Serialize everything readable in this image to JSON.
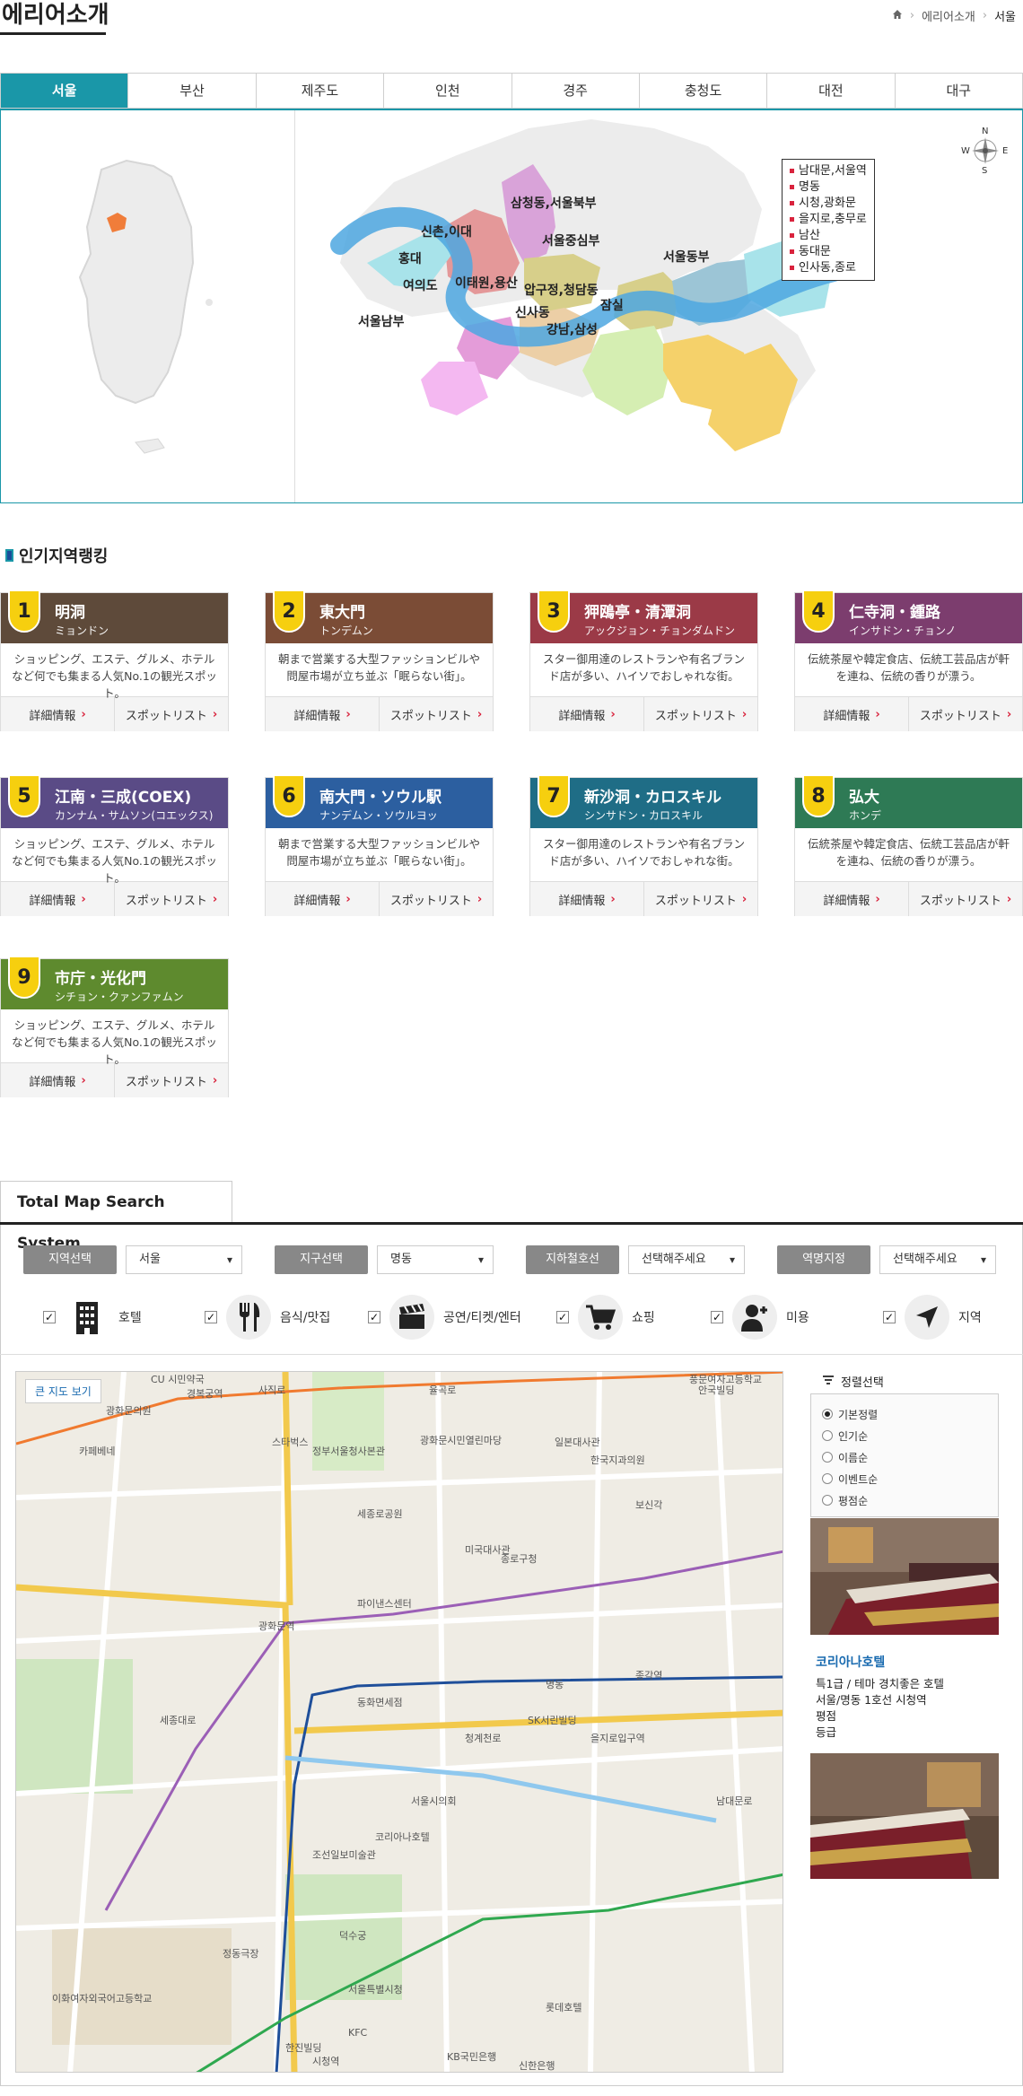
{
  "page": {
    "title": "에리어소개"
  },
  "breadcrumb": {
    "home_icon": "home-icon",
    "item1": "에리어소개",
    "current": "서울"
  },
  "tabs": [
    {
      "label": "서울",
      "active": true
    },
    {
      "label": "부산"
    },
    {
      "label": "제주도"
    },
    {
      "label": "인천"
    },
    {
      "label": "경주"
    },
    {
      "label": "충청도"
    },
    {
      "label": "대전"
    },
    {
      "label": "대구"
    }
  ],
  "compass": {
    "n": "N",
    "s": "S",
    "e": "E",
    "w": "W"
  },
  "zones": [
    {
      "label": "삼청동,서울북부"
    },
    {
      "label": "신촌,이대"
    },
    {
      "label": "서울중심부"
    },
    {
      "label": "홍대"
    },
    {
      "label": "서울동부"
    },
    {
      "label": "여의도"
    },
    {
      "label": "이태원,용산"
    },
    {
      "label": "압구정,청담동"
    },
    {
      "label": "신사동"
    },
    {
      "label": "잠실"
    },
    {
      "label": "강남,삼성"
    },
    {
      "label": "서울남부"
    }
  ],
  "legend": [
    "남대문,서울역",
    "명동",
    "시청,광화문",
    "을지로,충무로",
    "남산",
    "동대문",
    "인사동,종로"
  ],
  "ranking": {
    "title": "인기지역랭킹",
    "cards": [
      {
        "num": "1",
        "jp": "明洞",
        "kana": "ミョンドン",
        "color": "#5e4a3a",
        "desc": "ショッピング、エステ、グルメ、ホテルなど何でも集まる人気No.1の観光スポット。",
        "btn1": "詳細情報",
        "btn2": "スポットリスト"
      },
      {
        "num": "2",
        "jp": "東大門",
        "kana": "トンデムン",
        "color": "#7b4c36",
        "desc": "朝まで営業する大型ファッションビルや問屋市場が立ち並ぶ「眠らない街」。",
        "btn1": "詳細情報",
        "btn2": "スポットリスト"
      },
      {
        "num": "3",
        "jp": "狎鴎亭・清潭洞",
        "kana": "アックジョン・チョンダムドン",
        "color": "#9b3a47",
        "desc": "スター御用達のレストランや有名ブランド店が多い、ハイソでおしゃれな街。",
        "btn1": "詳細情報",
        "btn2": "スポットリスト"
      },
      {
        "num": "4",
        "jp": "仁寺洞・鍾路",
        "kana": "インサドン・チョンノ",
        "color": "#7c3d6e",
        "desc": "伝統茶屋や韓定食店、伝統工芸品店が軒を連ね、伝統の香りが漂う。",
        "btn1": "詳細情報",
        "btn2": "スポットリスト"
      },
      {
        "num": "5",
        "jp": "江南・三成(COEX)",
        "kana": "カンナム・サムソン(コエックス)",
        "color": "#5a4b86",
        "desc": "ショッピング、エステ、グルメ、ホテルなど何でも集まる人気No.1の観光スポット。",
        "btn1": "詳細情報",
        "btn2": "スポットリスト"
      },
      {
        "num": "6",
        "jp": "南大門・ソウル駅",
        "kana": "ナンデムン・ソウルヨッ",
        "color": "#2c5fa0",
        "desc": "朝まで営業する大型ファッションビルや問屋市場が立ち並ぶ「眠らない街」。",
        "btn1": "詳細情報",
        "btn2": "スポットリスト"
      },
      {
        "num": "7",
        "jp": "新沙洞・カロスキル",
        "kana": "シンサドン・カロスキル",
        "color": "#1f6d86",
        "desc": "スター御用達のレストランや有名ブランド店が多い、ハイソでおしゃれな街。",
        "btn1": "詳細情報",
        "btn2": "スポットリスト"
      },
      {
        "num": "8",
        "jp": "弘大",
        "kana": "ホンデ",
        "color": "#2e7a55",
        "desc": "伝統茶屋や韓定食店、伝統工芸品店が軒を連ね、伝統の香りが漂う。",
        "btn1": "詳細情報",
        "btn2": "スポットリスト"
      },
      {
        "num": "9",
        "jp": "市庁・光化門",
        "kana": "シチョン・クァンファムン",
        "color": "#5e8a2e",
        "desc": "ショッピング、エステ、グルメ、ホテルなど何でも集まる人気No.1の観光スポット。",
        "btn1": "詳細情報",
        "btn2": "スポットリスト"
      }
    ]
  },
  "total_map": {
    "tab": "Total Map Search System",
    "filters": [
      {
        "label": "지역선택",
        "value": "서울"
      },
      {
        "label": "지구선택",
        "value": "명동"
      },
      {
        "label": "지하철호선",
        "value": "선택해주세요"
      },
      {
        "label": "역명지정",
        "value": "선택해주세요"
      }
    ],
    "categories": [
      {
        "label": "호텔",
        "icon": "building-icon"
      },
      {
        "label": "음식/맛집",
        "icon": "fork-knife-icon"
      },
      {
        "label": "공연/티켓/엔터",
        "icon": "clapperboard-icon"
      },
      {
        "label": "쇼핑",
        "icon": "cart-icon"
      },
      {
        "label": "미용",
        "icon": "person-plus-icon"
      },
      {
        "label": "지역",
        "icon": "navigation-arrow-icon"
      }
    ],
    "big_map_btn": "큰 지도 보기",
    "map_labels": [
      "CU 시민약국",
      "경복궁역",
      "사직로",
      "율곡로",
      "광화문의원",
      "카페베네",
      "스타벅스",
      "정부서울청사본관",
      "광화문시민열린마당",
      "일본대사관",
      "한국지과의원",
      "풍문여자고등학교",
      "안국빌딩",
      "세종로공원",
      "미국대사관",
      "종로구청",
      "파이낸스센터",
      "광화문역",
      "을지로입구역",
      "서울특별시청",
      "덕수궁",
      "명동",
      "남대문로",
      "시청역",
      "KFC",
      "신한은행",
      "롯데호텔",
      "청계천로",
      "종각역",
      "코리아나호텔",
      "세종대로",
      "정동극장",
      "이화여자외국어고등학교",
      "동화면세점",
      "서울시의회",
      "조선일보미술관",
      "SK서린빌딩",
      "보신각",
      "KB국민은행",
      "한진빌딩"
    ],
    "sort": {
      "title": "정렬선택",
      "options": [
        {
          "label": "기본정렬",
          "checked": true
        },
        {
          "label": "인기순"
        },
        {
          "label": "이름순"
        },
        {
          "label": "이벤트순"
        },
        {
          "label": "평점순"
        }
      ]
    },
    "hotel": {
      "name": "코리아나호텔",
      "line1": "특1급 / 테마 경치좋은 호텔",
      "line2": "서울/명동 1호선 시청역",
      "line3": "평점",
      "line4": "등급"
    }
  }
}
